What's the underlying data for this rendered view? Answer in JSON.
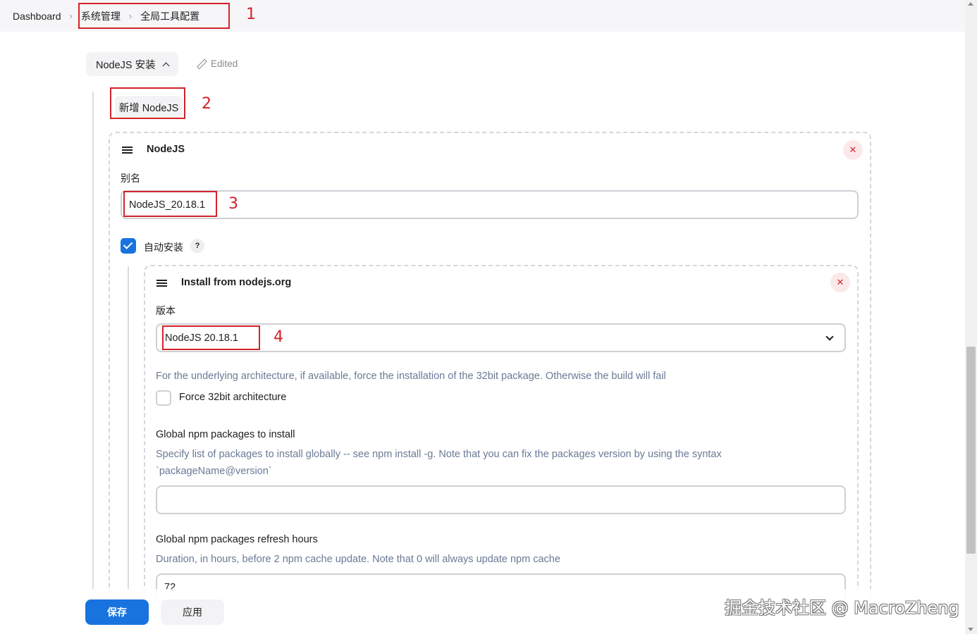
{
  "breadcrumb": {
    "items": [
      "Dashboard",
      "系统管理",
      "全局工具配置"
    ]
  },
  "annotations": [
    "1",
    "2",
    "3",
    "4"
  ],
  "section": {
    "title": "NodeJS 安装",
    "edited_label": "Edited",
    "add_button": "新增 NodeJS"
  },
  "nodejs_card": {
    "title": "NodeJS",
    "close": "✕",
    "alias_label": "别名",
    "alias_value": "NodeJS_20.18.1",
    "auto_install_label": "自动安装",
    "help": "?"
  },
  "installer_card": {
    "title": "Install from nodejs.org",
    "close": "✕",
    "version_label": "版本",
    "version_value": "NodeJS 20.18.1",
    "force32_help": "For the underlying architecture, if available, force the installation of the 32bit package. Otherwise the build will fail",
    "force32_label": "Force 32bit architecture",
    "npm_packages_label": "Global npm packages to install",
    "npm_packages_help_1": "Specify list of packages to install globally -- see npm install -g. Note that you can fix the packages version by using the syntax",
    "npm_packages_help_2": "`packageName@version`",
    "npm_packages_value": "",
    "refresh_label": "Global npm packages refresh hours",
    "refresh_help": "Duration, in hours, before 2 npm cache update. Note that 0 will always update npm cache",
    "refresh_value": "72"
  },
  "footer": {
    "save": "保存",
    "apply": "应用",
    "watermark": "掘金技术社区 @ MacroZheng"
  },
  "colors": {
    "primary": "#1873de",
    "annotation": "#d3222a",
    "help_text": "#6a7a95"
  }
}
